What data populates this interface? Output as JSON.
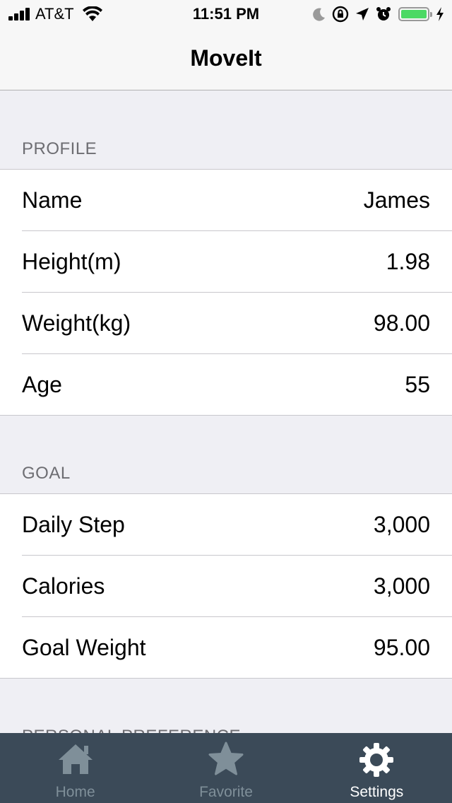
{
  "status_bar": {
    "carrier": "AT&T",
    "time": "11:51 PM",
    "battery_level": 1.0,
    "icons": [
      "signal-icon",
      "wifi-icon",
      "moon-icon",
      "orientation-lock-icon",
      "location-icon",
      "alarm-icon",
      "battery-icon",
      "charging-icon"
    ]
  },
  "nav": {
    "title": "MoveIt"
  },
  "sections": {
    "profile": {
      "header": "PROFILE",
      "rows": [
        {
          "label": "Name",
          "value": "James"
        },
        {
          "label": "Height(m)",
          "value": "1.98"
        },
        {
          "label": "Weight(kg)",
          "value": "98.00"
        },
        {
          "label": "Age",
          "value": "55"
        }
      ]
    },
    "goal": {
      "header": "GOAL",
      "rows": [
        {
          "label": "Daily Step",
          "value": "3,000"
        },
        {
          "label": "Calories",
          "value": "3,000"
        },
        {
          "label": "Goal Weight",
          "value": "95.00"
        }
      ]
    },
    "preference": {
      "header": "PERSONAL PREFERENCE"
    }
  },
  "tab_bar": {
    "tabs": [
      {
        "label": "Home",
        "icon": "home-icon",
        "active": false
      },
      {
        "label": "Favorite",
        "icon": "star-icon",
        "active": false
      },
      {
        "label": "Settings",
        "icon": "gear-icon",
        "active": true
      }
    ],
    "colors": {
      "background": "#3b4a58",
      "inactive": "#7f8f99",
      "active": "#ffffff"
    }
  }
}
